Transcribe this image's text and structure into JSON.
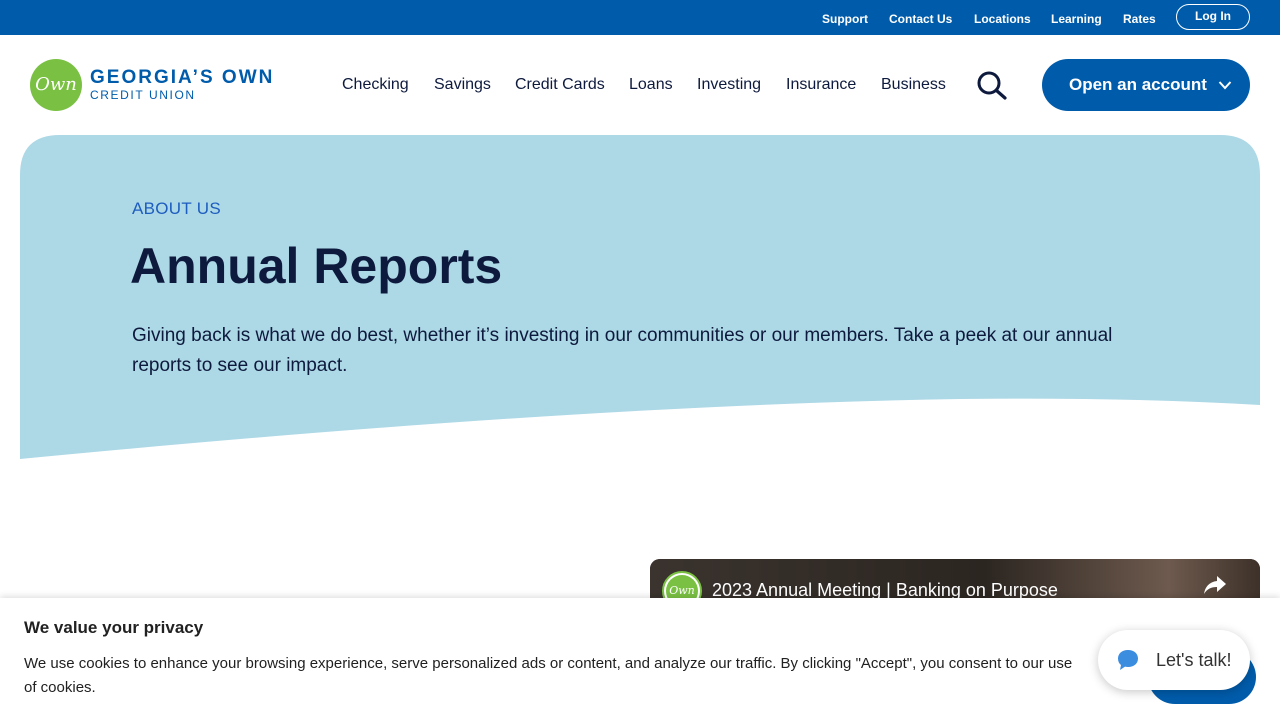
{
  "utility_nav": {
    "items": [
      "Support",
      "Contact Us",
      "Locations",
      "Learning",
      "Rates"
    ],
    "login_label": "Log In"
  },
  "logo": {
    "mark": "Own",
    "line1": "GEORGIA’S OWN",
    "line2": "CREDIT UNION"
  },
  "main_nav": {
    "items": [
      "Checking",
      "Savings",
      "Credit Cards",
      "Loans",
      "Investing",
      "Insurance",
      "Business"
    ],
    "search_icon": "search-icon",
    "cta_label": "Open an account"
  },
  "hero": {
    "eyebrow": "ABOUT US",
    "title": "Annual Reports",
    "description": "Giving back is what we do best, whether it’s investing in our communities or our members. Take a peek at our annual reports to see our impact."
  },
  "video": {
    "channel_mark": "Own",
    "title": "2023 Annual Meeting | Banking on Purpose",
    "share_icon": "share-icon"
  },
  "cookie_banner": {
    "title": "We value your privacy",
    "text": "We use cookies to enhance your browsing experience, serve personalized ads or content, and analyze our traffic. By clicking \"Accept\", you consent to our use of cookies."
  },
  "chat": {
    "label": "Let's talk!",
    "icon": "chat-bubble-icon"
  },
  "colors": {
    "brand_blue": "#005cab",
    "brand_green": "#7ac143",
    "hero_bg": "#add8e6",
    "text_dark": "#0e1a3d"
  }
}
